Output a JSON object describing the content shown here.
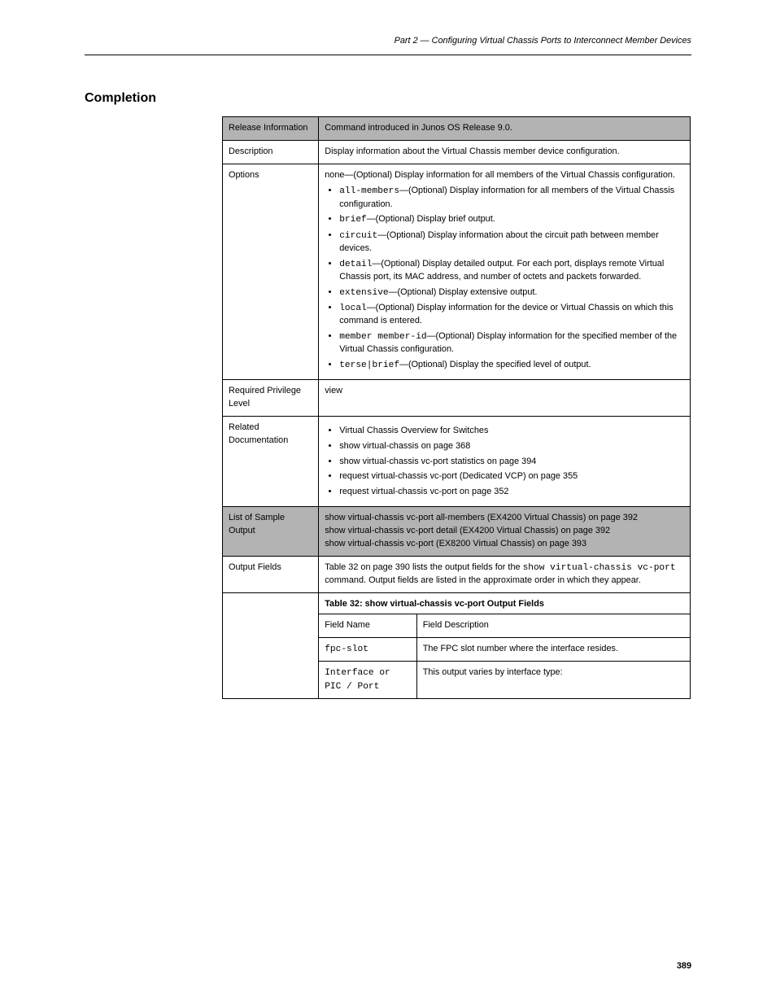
{
  "header": {
    "running_title": "Part 2 — Configuring Virtual Chassis Ports to Interconnect Member Devices"
  },
  "section": {
    "title": "Completion"
  },
  "table": {
    "rows": [
      {
        "shaded": true,
        "left": "Release Information",
        "right": "Command introduced in Junos OS Release 9.0."
      },
      {
        "shaded": false,
        "left": "Description",
        "right": "Display information about the Virtual Chassis member device configuration."
      },
      {
        "shaded": false,
        "left": "Options",
        "right_label": "none—(Optional) Display information for all members of the Virtual Chassis configuration.",
        "options": [
          {
            "name": "all-members",
            "desc": "—(Optional) Display information for all members of the Virtual Chassis configuration."
          },
          {
            "name": "brief",
            "desc": "—(Optional) Display brief output."
          },
          {
            "name": "circuit",
            "desc": "—(Optional) Display information about the circuit path between member devices."
          },
          {
            "name": "detail",
            "desc": "—(Optional) Display detailed output. For each port, displays remote Virtual Chassis port, its MAC address, and number of octets and packets forwarded."
          },
          {
            "name": "extensive",
            "desc": "—(Optional) Display extensive output."
          },
          {
            "name": "local",
            "desc": "—(Optional) Display information for the device or Virtual Chassis on which this command is entered."
          },
          {
            "name": "member member-id",
            "desc": "—(Optional) Display information for the specified member of the Virtual Chassis configuration."
          },
          {
            "name": "terse|brief",
            "desc": "—(Optional) Display the specified level of output."
          }
        ]
      },
      {
        "shaded": false,
        "left": "Required Privilege Level",
        "right": "view"
      },
      {
        "shaded": false,
        "left": "Related Documentation",
        "related": [
          {
            "title": "Virtual Chassis Overview for Switches"
          },
          {
            "title": "show virtual-chassis",
            "page": "on page 368"
          },
          {
            "title": "show virtual-chassis vc-port statistics",
            "page": "on page 394"
          },
          {
            "title": "request virtual-chassis vc-port (Dedicated VCP)",
            "page": "on page 355"
          },
          {
            "title": "request virtual-chassis vc-port",
            "page": "on page 352"
          }
        ]
      },
      {
        "shaded": true,
        "left": "List of Sample Output",
        "list_items": [
          "show virtual-chassis vc-port all-members (EX4200 Virtual Chassis) on page 392",
          "show virtual-chassis vc-port detail (EX4200 Virtual Chassis) on page 392",
          "show virtual-chassis vc-port (EX8200 Virtual Chassis) on page 393"
        ]
      },
      {
        "shaded": false,
        "left": "Output Fields",
        "right_prefix": "Table 32 on page 390 lists the output fields for the ",
        "right_cmd": "show virtual-chassis vc-port",
        "right_suffix": " command. Output fields are listed in the approximate order in which they appear."
      },
      {
        "shaded": false,
        "left": "",
        "right_label_bold": "Table 32: show virtual-chassis vc-port Output Fields",
        "subtable": {
          "headers": [
            "Field Name",
            "Field Description"
          ],
          "rows": [
            [
              "fpc-slot",
              "The FPC slot number where the interface resides."
            ],
            [
              "Interface or PIC / Port",
              "This output varies by interface type:"
            ]
          ]
        }
      }
    ]
  },
  "footer": {
    "page_number": "389"
  }
}
